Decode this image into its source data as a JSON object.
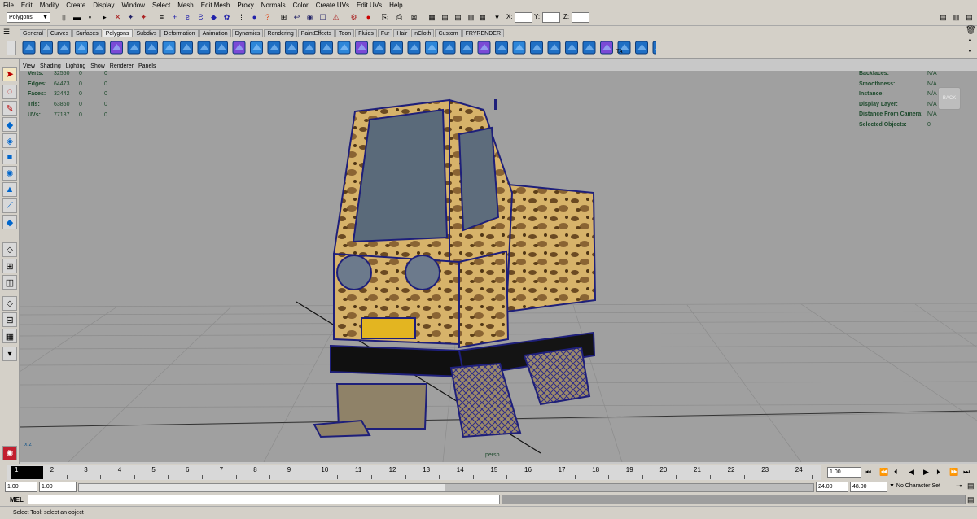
{
  "menus": [
    "File",
    "Edit",
    "Modify",
    "Create",
    "Display",
    "Window",
    "Select",
    "Mesh",
    "Edit Mesh",
    "Proxy",
    "Normals",
    "Color",
    "Create UVs",
    "Edit UVs",
    "Help"
  ],
  "status": {
    "mode": "Polygons",
    "x_label": "X:",
    "y_label": "Y:",
    "z_label": "Z:"
  },
  "shelf_tabs": [
    "General",
    "Curves",
    "Surfaces",
    "Polygons",
    "Subdivs",
    "Deformation",
    "Animation",
    "Dynamics",
    "Rendering",
    "PaintEffects",
    "Toon",
    "Fluids",
    "Fur",
    "Hair",
    "nCloth",
    "Custom",
    "FRYRENDER"
  ],
  "active_shelf_tab": "Polygons",
  "shelf_last_label": "TA",
  "panel_menu": [
    "View",
    "Shading",
    "Lighting",
    "Show",
    "Renderer",
    "Panels"
  ],
  "hud_left": [
    {
      "label": "Verts:",
      "v1": "32550",
      "v2": "0",
      "v3": "0"
    },
    {
      "label": "Edges:",
      "v1": "64473",
      "v2": "0",
      "v3": "0"
    },
    {
      "label": "Faces:",
      "v1": "32442",
      "v2": "0",
      "v3": "0"
    },
    {
      "label": "Tris:",
      "v1": "63860",
      "v2": "0",
      "v3": "0"
    },
    {
      "label": "UVs:",
      "v1": "77187",
      "v2": "0",
      "v3": "0"
    }
  ],
  "hud_right": [
    {
      "label": "Backfaces:",
      "value": "N/A"
    },
    {
      "label": "Smoothness:",
      "value": "N/A"
    },
    {
      "label": "Instance:",
      "value": "N/A"
    },
    {
      "label": "Display Layer:",
      "value": "N/A"
    },
    {
      "label": "Distance From Camera:",
      "value": "N/A"
    },
    {
      "label": "Selected Objects:",
      "value": "0"
    }
  ],
  "viewcube_label": "BACK",
  "camera_label": "persp",
  "axis_label": "x z",
  "timeline": {
    "ticks": [
      "1",
      "2",
      "3",
      "4",
      "5",
      "6",
      "7",
      "8",
      "9",
      "10",
      "11",
      "12",
      "13",
      "14",
      "15",
      "16",
      "17",
      "18",
      "19",
      "20",
      "21",
      "22",
      "23",
      "24"
    ],
    "current_frame": "1.00"
  },
  "range": {
    "start": "1.00",
    "start2": "1.00",
    "end": "24.00",
    "end2": "48.00",
    "character_set": "No Character Set"
  },
  "cmd_label": "MEL",
  "help_text": "Select Tool: select an object"
}
